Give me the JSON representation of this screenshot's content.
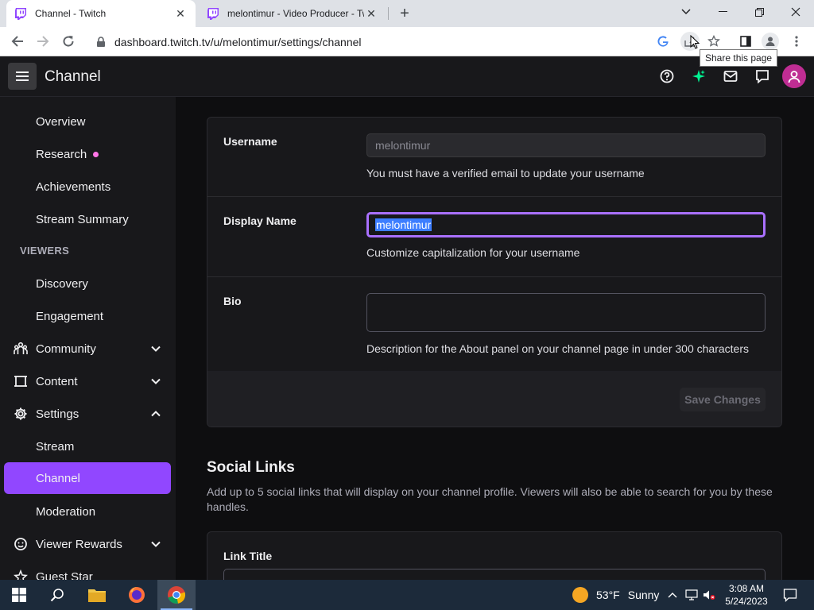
{
  "browser": {
    "tabs": [
      {
        "title": "Channel - Twitch",
        "active": true
      },
      {
        "title": "melontimur - Video Producer - Twitch",
        "active": false
      }
    ],
    "url": "dashboard.twitch.tv/u/melontimur/settings/channel",
    "tooltip": "Share this page"
  },
  "header": {
    "title": "Channel"
  },
  "sidebar": {
    "items": [
      {
        "label": "Overview"
      },
      {
        "label": "Research"
      },
      {
        "label": "Achievements"
      },
      {
        "label": "Stream Summary"
      },
      {
        "label": "Discovery"
      },
      {
        "label": "Engagement"
      },
      {
        "label": "Community"
      },
      {
        "label": "Content"
      },
      {
        "label": "Settings"
      },
      {
        "label": "Stream"
      },
      {
        "label": "Channel"
      },
      {
        "label": "Moderation"
      },
      {
        "label": "Viewer Rewards"
      },
      {
        "label": "Guest Star"
      }
    ],
    "section_viewers": "VIEWERS"
  },
  "profile": {
    "username_label": "Username",
    "username_value": "melontimur",
    "username_hint": "You must have a verified email to update your username",
    "display_name_label": "Display Name",
    "display_name_value": "melontimur",
    "display_name_hint": "Customize capitalization for your username",
    "bio_label": "Bio",
    "bio_value": "",
    "bio_hint": "Description for the About panel on your channel page in under 300 characters",
    "save_label": "Save Changes"
  },
  "social": {
    "title": "Social Links",
    "description": "Add up to 5 social links that will display on your channel profile. Viewers will also be able to search for you by these handles.",
    "link_title_label": "Link Title"
  },
  "taskbar": {
    "temperature": "53°F",
    "condition": "Sunny",
    "time": "3:08 AM",
    "date": "5/24/2023"
  },
  "colors": {
    "accent": "#9147ff",
    "focus": "#a970ff",
    "background": "#0e0e10",
    "surface": "#18181b"
  }
}
